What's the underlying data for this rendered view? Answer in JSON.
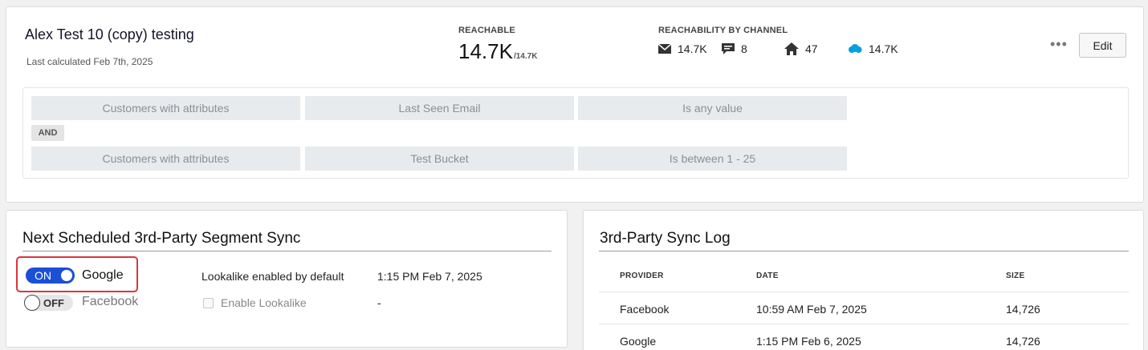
{
  "segment": {
    "title": "Alex Test 10 (copy) testing",
    "last_calculated": "Last calculated Feb 7th, 2025",
    "reachable_label": "REACHABLE",
    "reachable_value": "14.7K",
    "reachable_total": "/14.7K",
    "channels_label": "REACHABILITY BY CHANNEL",
    "channels": [
      {
        "icon": "envelope-icon",
        "value": "14.7K"
      },
      {
        "icon": "chat-bubble-icon",
        "value": "8"
      },
      {
        "icon": "home-icon",
        "value": "47"
      },
      {
        "icon": "salesforce-cloud-icon",
        "value": "14.7K"
      }
    ],
    "more_label": "•••",
    "edit_label": "Edit"
  },
  "criteria": {
    "rows": [
      [
        "Customers with attributes",
        "Last Seen Email",
        "Is any value"
      ],
      [
        "Customers with attributes",
        "Test Bucket",
        "Is between 1 - 25"
      ]
    ],
    "conjunction": "AND"
  },
  "schedule": {
    "title": "Next Scheduled 3rd-Party Segment Sync",
    "providers": [
      {
        "toggle": "ON",
        "name": "Google",
        "lookalike": "Lookalike enabled by default",
        "time": "1:15 PM Feb 7, 2025"
      },
      {
        "toggle": "OFF",
        "name": "Facebook",
        "lookalike": "Enable Lookalike",
        "time": "-"
      }
    ]
  },
  "sync_log": {
    "title": "3rd-Party Sync Log",
    "columns": [
      "PROVIDER",
      "DATE",
      "SIZE"
    ],
    "rows": [
      [
        "Facebook",
        "10:59 AM Feb 7, 2025",
        "14,726"
      ],
      [
        "Google",
        "1:15 PM Feb 6, 2025",
        "14,726"
      ]
    ]
  },
  "colors": {
    "toggle_on": "#1a4fd6",
    "highlight": "#d9363e",
    "salesforce": "#00a1e0"
  }
}
